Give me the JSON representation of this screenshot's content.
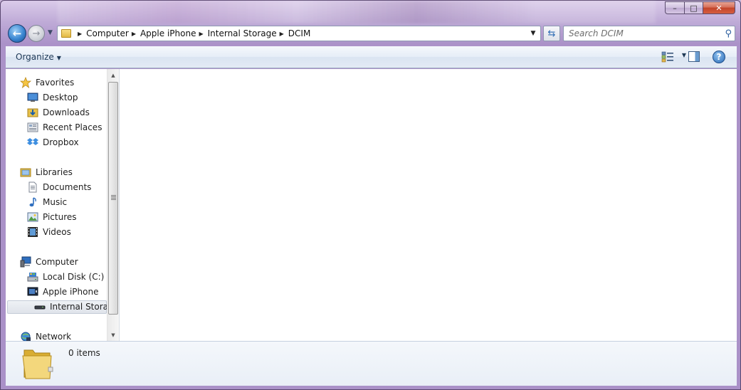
{
  "window": {
    "controls": {
      "minimize": "–",
      "maximize": "□",
      "close": "✕"
    }
  },
  "nav": {
    "back_icon": "←",
    "forward_icon": "→",
    "breadcrumb": [
      "Computer",
      "Apple iPhone",
      "Internal Storage",
      "DCIM"
    ],
    "breadcrumb_separator": "▶",
    "search_placeholder": "Search DCIM"
  },
  "toolbar": {
    "organize_label": "Organize",
    "organize_caret": "▼",
    "help_label": "?"
  },
  "sidebar": {
    "favorites": {
      "label": "Favorites",
      "items": [
        {
          "label": "Desktop",
          "icon": "desktop-icon"
        },
        {
          "label": "Downloads",
          "icon": "downloads-icon"
        },
        {
          "label": "Recent Places",
          "icon": "recent-places-icon"
        },
        {
          "label": "Dropbox",
          "icon": "dropbox-icon"
        }
      ]
    },
    "libraries": {
      "label": "Libraries",
      "items": [
        {
          "label": "Documents",
          "icon": "documents-icon"
        },
        {
          "label": "Music",
          "icon": "music-icon"
        },
        {
          "label": "Pictures",
          "icon": "pictures-icon"
        },
        {
          "label": "Videos",
          "icon": "videos-icon"
        }
      ]
    },
    "computer": {
      "label": "Computer",
      "items": [
        {
          "label": "Local Disk (C:)",
          "icon": "local-disk-icon"
        },
        {
          "label": "Apple iPhone",
          "icon": "iphone-icon"
        },
        {
          "label": "Internal Storage",
          "icon": "storage-icon",
          "selected": true
        }
      ]
    },
    "network": {
      "label": "Network"
    }
  },
  "details": {
    "items_count": "0 items"
  },
  "colors": {
    "accent": "#2c6cb7",
    "folder": "#e8c14a",
    "window_frame": "#b8a0cf"
  }
}
